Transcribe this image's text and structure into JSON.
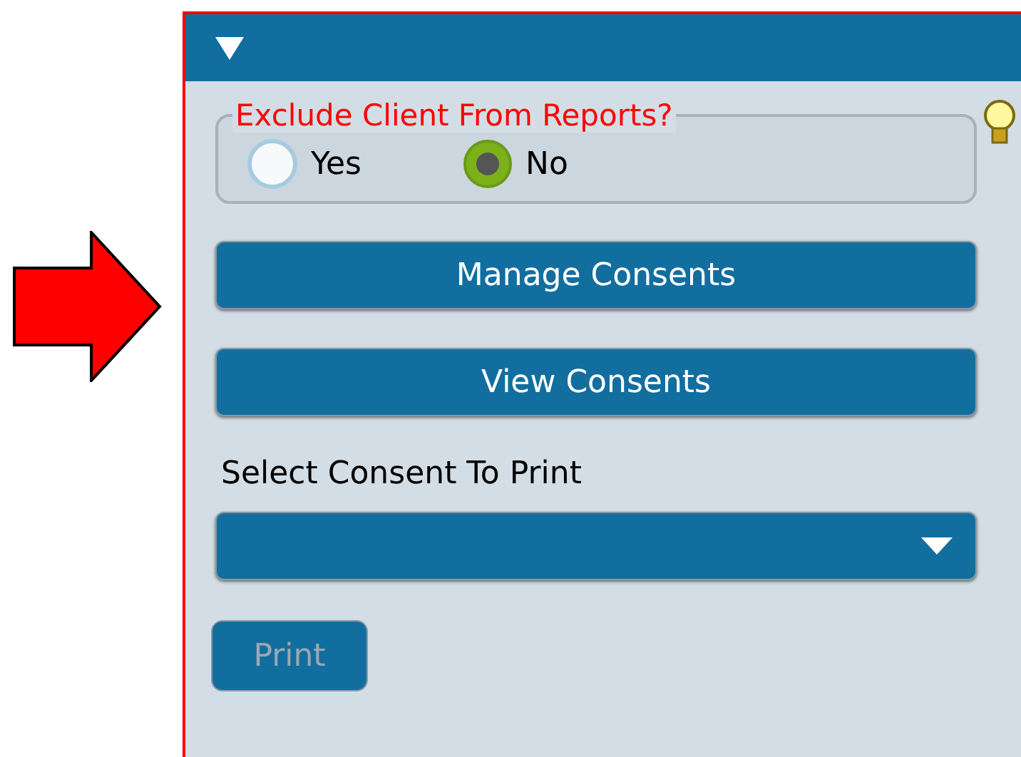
{
  "section": {
    "expanded": true
  },
  "exclude_question": {
    "label": "Exclude Client From Reports?",
    "options": [
      {
        "label": "Yes",
        "selected": false
      },
      {
        "label": "No",
        "selected": true
      }
    ]
  },
  "buttons": [
    {
      "label": "Manage Consents",
      "disabled": false
    },
    {
      "label": "View Consents",
      "disabled": false
    }
  ],
  "consent_select": {
    "label": "Select Consent To Print"
  },
  "print_button": {
    "label": "Print",
    "disabled": true
  }
}
